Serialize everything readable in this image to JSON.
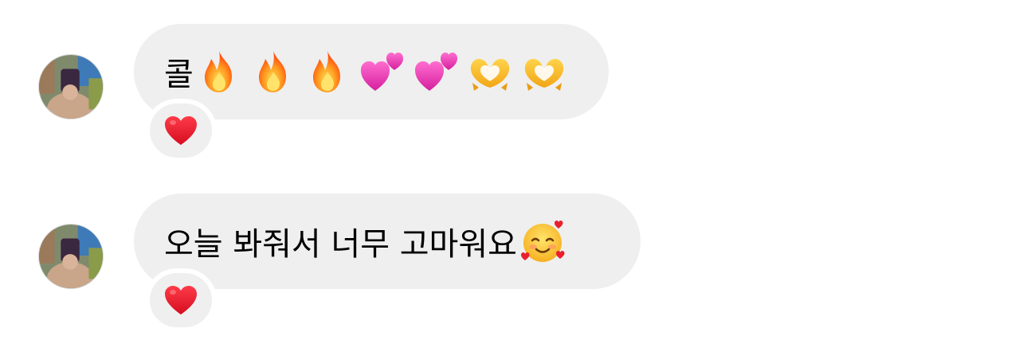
{
  "messages": [
    {
      "text": "콜",
      "emojis": [
        "fire-emoji",
        "fire-emoji",
        "fire-emoji",
        "two-hearts-emoji",
        "two-hearts-emoji",
        "heart-hands-emoji",
        "heart-hands-emoji"
      ],
      "reaction": "red-heart-emoji"
    },
    {
      "text": "오늘 봐줘서 너무 고마워요",
      "emojis": [
        "smiling-face-with-hearts-emoji"
      ],
      "reaction": "red-heart-emoji"
    }
  ],
  "colors": {
    "bubble": "#efefef",
    "text": "#000000",
    "background": "#ffffff",
    "heart": "#e0142b"
  }
}
